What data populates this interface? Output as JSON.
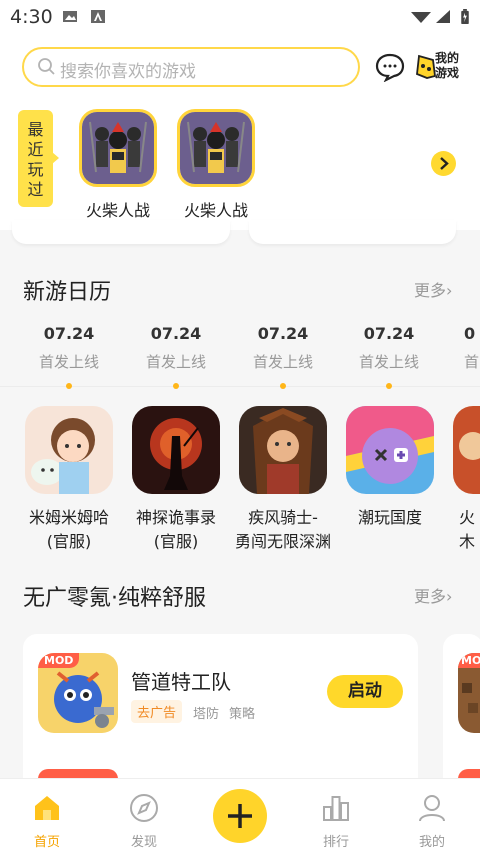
{
  "status_bar": {
    "time": "4:30"
  },
  "search": {
    "placeholder": "搜索你喜欢的游戏"
  },
  "header": {
    "my_games_label_1": "我的",
    "my_games_label_2": "游戏"
  },
  "recent": {
    "tag_chars": [
      "最",
      "近",
      "玩",
      "过"
    ],
    "games": [
      {
        "name": "火柴人战"
      },
      {
        "name": "火柴人战"
      }
    ]
  },
  "calendar_section": {
    "title": "新游日历",
    "more": "更多",
    "dates": [
      {
        "date": "07.24",
        "status": "首发上线"
      },
      {
        "date": "07.24",
        "status": "首发上线"
      },
      {
        "date": "07.24",
        "status": "首发上线"
      },
      {
        "date": "07.24",
        "status": "首发上线"
      },
      {
        "date": "0",
        "status": "首"
      }
    ],
    "games": [
      {
        "line1": "米姆米姆哈",
        "line2": "(官服)"
      },
      {
        "line1": "神探诡事录",
        "line2": "(官服)"
      },
      {
        "line1": "疾风骑士-",
        "line2": "勇闯无限深渊"
      },
      {
        "line1": "潮玩国度",
        "line2": ""
      },
      {
        "line1": "火",
        "line2": "木"
      }
    ]
  },
  "adfree_section": {
    "title": "无广零氪·纯粹舒服",
    "more": "更多",
    "card": {
      "badge": "MOD",
      "name": "管道特工队",
      "ad_tag": "去广告",
      "tags": [
        "塔防",
        "策略"
      ],
      "action": "启动"
    },
    "next_badge": "MOD"
  },
  "bottom_nav": {
    "items": [
      {
        "label": "首页",
        "active": true
      },
      {
        "label": "发现",
        "active": false
      },
      {
        "label": "排行",
        "active": false
      },
      {
        "label": "我的",
        "active": false
      }
    ]
  },
  "colors": {
    "accent": "#ffd42a",
    "active_text": "#f5a300",
    "ad_tag": "#f08a24",
    "badge": "#ff5e46"
  }
}
